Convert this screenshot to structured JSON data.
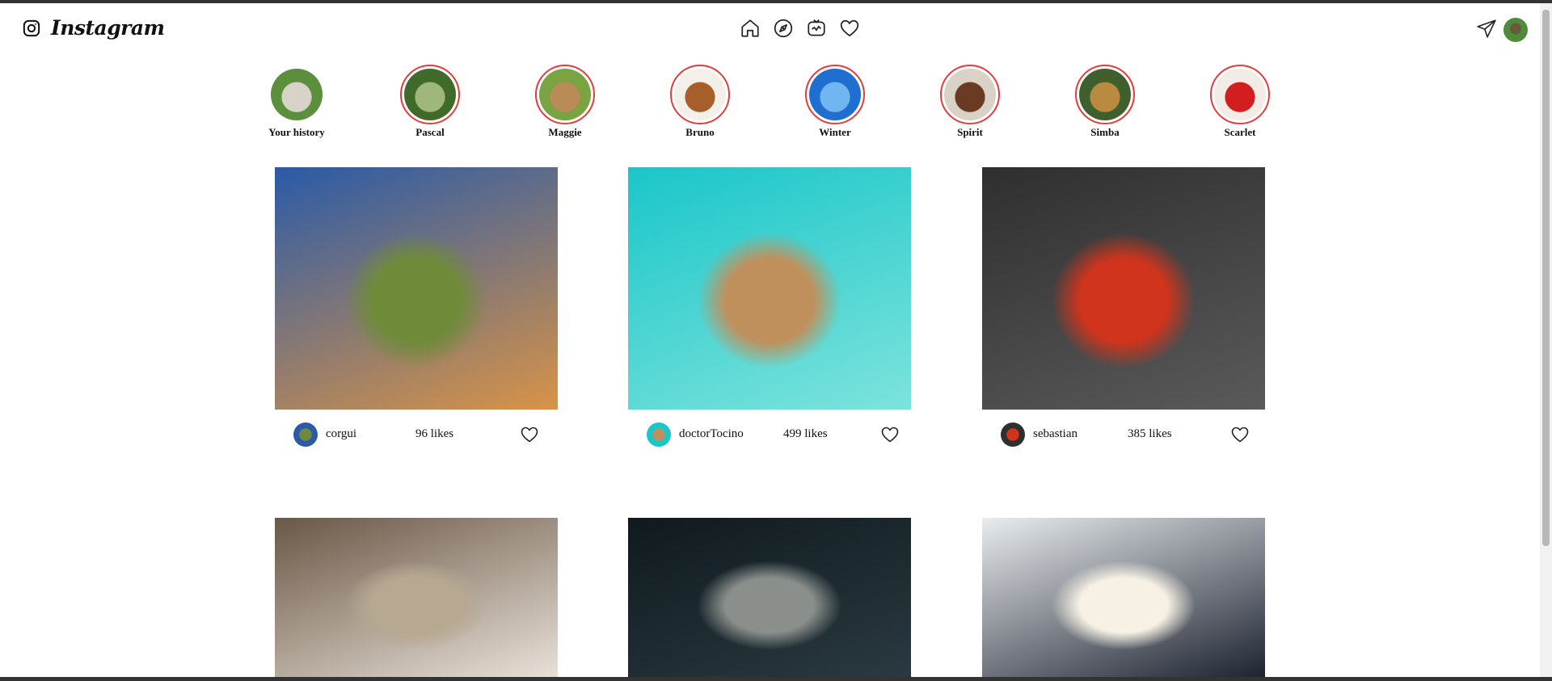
{
  "header": {
    "brand": "Instagram",
    "nav_icons": [
      "home-icon",
      "explore-icon",
      "reels-icon",
      "heart-icon"
    ],
    "right_icons": [
      "send-icon",
      "profile-avatar"
    ]
  },
  "stories": [
    {
      "name": "Your history",
      "active": false,
      "colors": [
        "#5c8f3c",
        "#d8d3c8"
      ]
    },
    {
      "name": "Pascal",
      "active": true,
      "colors": [
        "#3f6a2a",
        "#9fb77a"
      ]
    },
    {
      "name": "Maggie",
      "active": true,
      "colors": [
        "#7aa341",
        "#b98b57"
      ]
    },
    {
      "name": "Bruno",
      "active": true,
      "colors": [
        "#f3efe9",
        "#a85e2a"
      ]
    },
    {
      "name": "Winter",
      "active": true,
      "colors": [
        "#1e6fd0",
        "#6fb6f2"
      ]
    },
    {
      "name": "Spirit",
      "active": true,
      "colors": [
        "#d9d2c6",
        "#6a3b22"
      ]
    },
    {
      "name": "Simba",
      "active": true,
      "colors": [
        "#3f5f2d",
        "#b98a3f"
      ]
    },
    {
      "name": "Scarlet",
      "active": true,
      "colors": [
        "#f1ece6",
        "#d21e1e"
      ]
    }
  ],
  "posts": [
    {
      "user": "corgui",
      "likes": "96 likes",
      "colors": [
        "#2a5aa8",
        "#d89347",
        "#6f8b3a"
      ]
    },
    {
      "user": "doctorTocino",
      "likes": "499 likes",
      "colors": [
        "#1ac6c9",
        "#7de3dc",
        "#c0905c"
      ]
    },
    {
      "user": "sebastian",
      "likes": "385 likes",
      "colors": [
        "#2f2f2f",
        "#5a5a5a",
        "#d0341c"
      ]
    },
    {
      "user": "",
      "likes": "",
      "colors": [
        "#6a5746",
        "#e8e1d8",
        "#b7a892"
      ]
    },
    {
      "user": "",
      "likes": "",
      "colors": [
        "#0f1a1e",
        "#2a3a40",
        "#8a8f8c"
      ]
    },
    {
      "user": "",
      "likes": "",
      "colors": [
        "#e9ecef",
        "#1d2330",
        "#f6f1e4"
      ]
    }
  ]
}
